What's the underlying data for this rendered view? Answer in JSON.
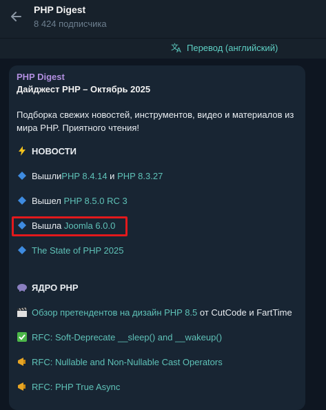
{
  "header": {
    "title": "PHP Digest",
    "subscribers": "8 424 подписчика"
  },
  "translate": {
    "label": "Перевод (английский)"
  },
  "post": {
    "channel": "PHP Digest",
    "title": "Дайджест PHP – Октябрь 2025",
    "intro": "Подборка свежих новостей, инструментов, видео и материалов из мира PHP. Приятного чтения!",
    "news_section": "НОВОСТИ",
    "news": [
      {
        "prefix": "Вышли ",
        "link1": "PHP 8.4.14",
        "mid": " и ",
        "link2": "PHP 8.3.27"
      },
      {
        "prefix": "Вышел ",
        "link1": "PHP 8.5.0 RC 3"
      },
      {
        "prefix": "Вышла ",
        "link1": "Joomla 6.0.0"
      },
      {
        "link1": "The State of PHP 2025"
      }
    ],
    "core_section": "ЯДРО PHP",
    "core": [
      {
        "link": "Обзор претендентов на дизайн PHP 8.5",
        "suffix": " от CutCode и FartTime"
      },
      {
        "link": "RFC: Soft-Deprecate __sleep() and __wakeup()"
      },
      {
        "link": "RFC: Nullable and Non-Nullable Cast Operators"
      },
      {
        "link": "RFC: PHP True Async"
      }
    ]
  },
  "colors": {
    "link": "#5fc2b8",
    "channel": "#b28fe0",
    "highlight": "#e3191c"
  },
  "icons": [
    "back-arrow-icon",
    "translate-icon",
    "lightning-icon",
    "blue-diamond-icon",
    "elephant-icon",
    "clapper-icon",
    "check-icon",
    "megaphone-icon"
  ]
}
